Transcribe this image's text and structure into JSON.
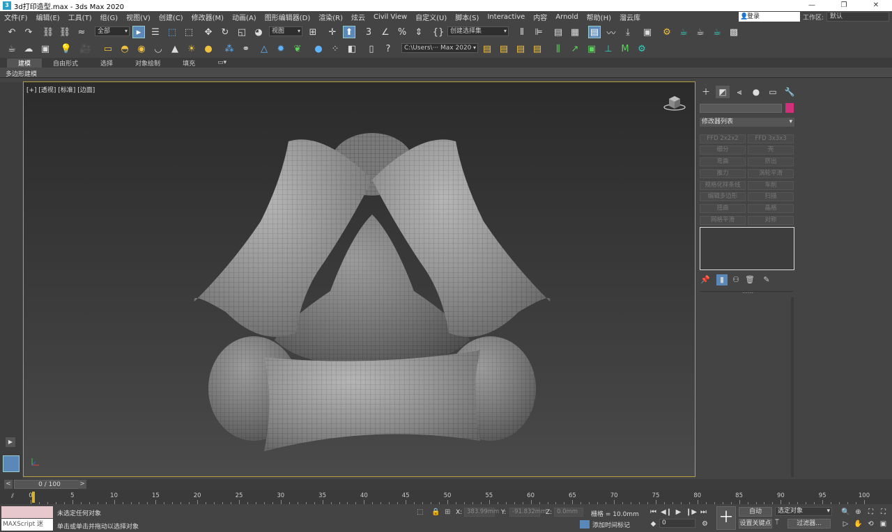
{
  "window": {
    "title": "3d打印造型.max - 3ds Max 2020",
    "app_icon": "3",
    "minimize": "—",
    "maximize": "❐",
    "close": "✕"
  },
  "menu": {
    "items": [
      "文件(F)",
      "编辑(E)",
      "工具(T)",
      "组(G)",
      "视图(V)",
      "创建(C)",
      "修改器(M)",
      "动画(A)",
      "图形编辑器(D)",
      "渲染(R)",
      "炫云",
      "Civil View",
      "自定义(U)",
      "脚本(S)",
      "Interactive",
      "内容",
      "Arnold",
      "帮助(H)",
      "溜云库"
    ],
    "login": "登录",
    "workspace_label": "工作区:",
    "workspace_value": "默认"
  },
  "toolbar": {
    "selection_filter": "全部",
    "ref_coord": "视图",
    "named_selection": "创建选择集",
    "project_path": "C:\\Users\\··· Max 2020"
  },
  "ribbon": {
    "tabs": [
      "建模",
      "自由形式",
      "选择",
      "对象绘制",
      "填充"
    ],
    "active_tab": "建模",
    "extra": "▭▾",
    "sub_label": "多边形建模"
  },
  "viewport": {
    "label": "[+] [透视] [标准] [边面]"
  },
  "command_panel": {
    "modifier_list": "修改器列表",
    "modifier_buttons": [
      "FFD 2x2x2",
      "FFD 3x3x3",
      "细分",
      "壳",
      "弯曲",
      "挤出",
      "推力",
      "涡轮平滑",
      "规格化样条线",
      "车削",
      "编辑多边形",
      "扫描",
      "扭曲",
      "晶格",
      "网格平滑",
      "对称"
    ],
    "accent_color": "#d0307a"
  },
  "timeline": {
    "slider": "0 / 100",
    "prev": "<",
    "next": ">",
    "ticks": [
      "0",
      "5",
      "10",
      "15",
      "20",
      "25",
      "30",
      "35",
      "40",
      "45",
      "50",
      "55",
      "60",
      "65",
      "70",
      "75",
      "80",
      "85",
      "90",
      "95",
      "100"
    ]
  },
  "status": {
    "maxscript": "MAXScript 迷",
    "line1": "未选定任何对象",
    "line2": "单击或单击并拖动以选择对象",
    "x_label": "X:",
    "x_value": "383.99mm",
    "y_label": "Y:",
    "y_value": "-91.832mm",
    "z_label": "Z:",
    "z_value": "0.0mm",
    "grid": "栅格 = 10.0mm",
    "add_time_tag": "添加时间标记",
    "auto_key": "自动",
    "set_key": "设置关键点",
    "selected_set": "选定对象",
    "filters": "过滤器...",
    "current_frame": "0"
  }
}
